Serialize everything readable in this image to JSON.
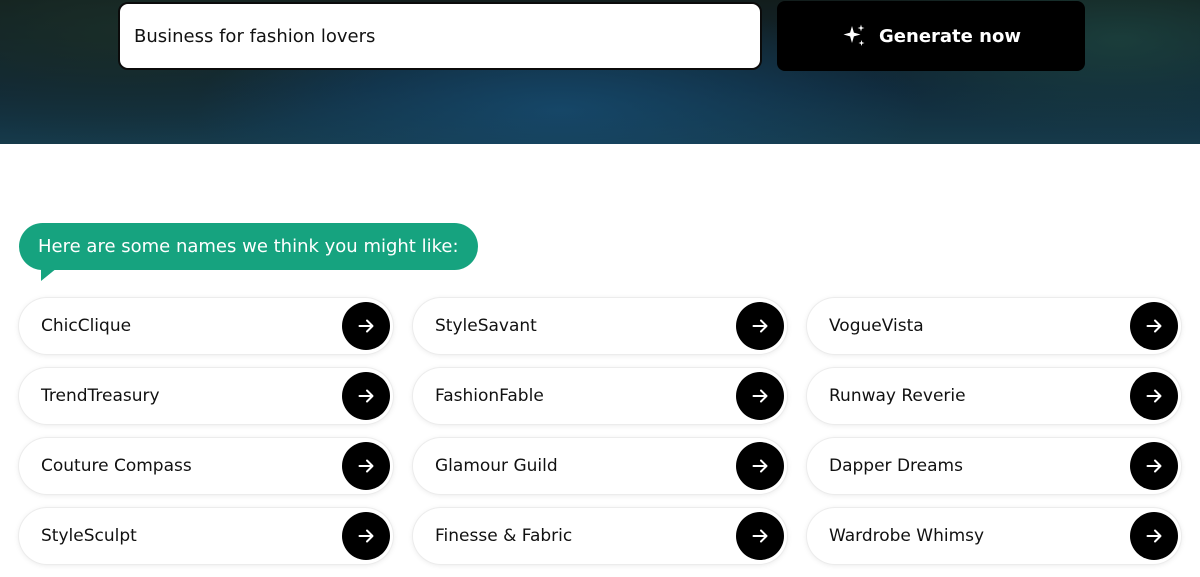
{
  "search": {
    "value": "Business for fashion lovers"
  },
  "generate_button": {
    "label": "Generate now",
    "icon": "sparkles-icon"
  },
  "suggestions": {
    "heading": "Here are some names we think you might like:",
    "accent_color": "#16a37f",
    "arrow_icon": "arrow-right-icon",
    "names": [
      "ChicClique",
      "StyleSavant",
      "VogueVista",
      "TrendTreasury",
      "FashionFable",
      "Runway Reverie",
      "Couture Compass",
      "Glamour Guild",
      "Dapper Dreams",
      "StyleSculpt",
      "Finesse & Fabric",
      "Wardrobe Whimsy"
    ]
  }
}
